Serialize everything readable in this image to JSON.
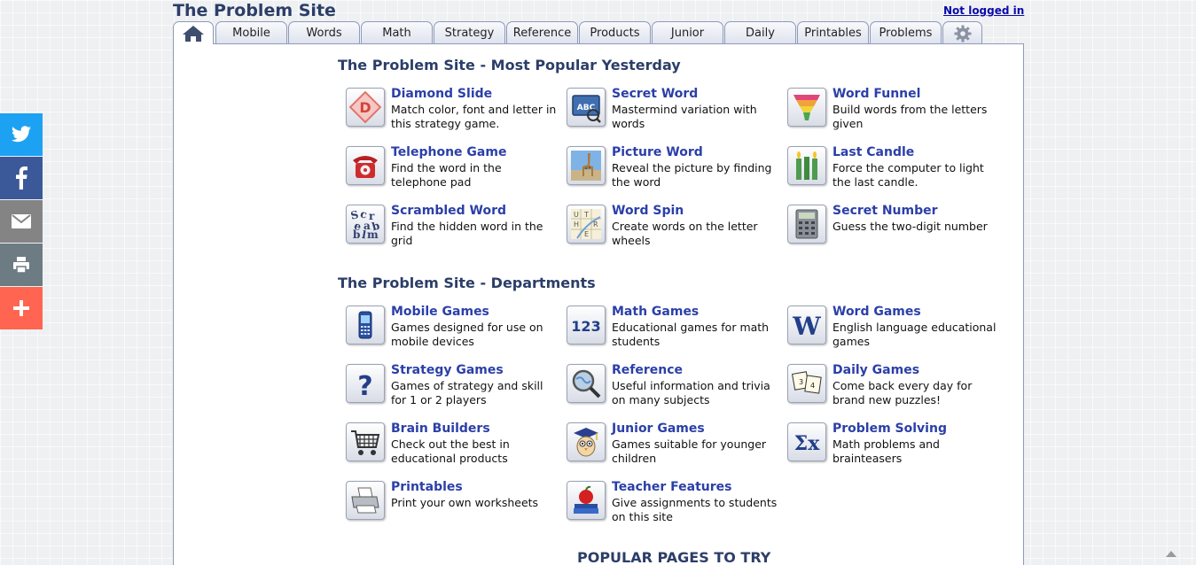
{
  "site": {
    "title": "The Problem Site",
    "login_status": "Not logged in"
  },
  "tabs": [
    {
      "label": "home",
      "icon": "home-icon"
    },
    {
      "label": "Mobile"
    },
    {
      "label": "Words"
    },
    {
      "label": "Math"
    },
    {
      "label": "Strategy"
    },
    {
      "label": "Reference"
    },
    {
      "label": "Products"
    },
    {
      "label": "Junior"
    },
    {
      "label": "Daily"
    },
    {
      "label": "Printables"
    },
    {
      "label": "Problems"
    },
    {
      "label": "settings",
      "icon": "gear-icon"
    }
  ],
  "popular_section": {
    "title": "The Problem Site - Most Popular Yesterday",
    "items": [
      {
        "title": "Diamond Slide",
        "desc": "Match color, font and letter in this strategy game.",
        "icon": "diamond-slide-icon"
      },
      {
        "title": "Secret Word",
        "desc": "Mastermind variation with words",
        "icon": "secret-word-icon"
      },
      {
        "title": "Word Funnel",
        "desc": "Build words from the letters given",
        "icon": "funnel-icon"
      },
      {
        "title": "Telephone Game",
        "desc": "Find the word in the telephone pad",
        "icon": "telephone-icon"
      },
      {
        "title": "Picture Word",
        "desc": "Reveal the picture by finding the word",
        "icon": "giraffe-picture-icon"
      },
      {
        "title": "Last Candle",
        "desc": "Force the computer to light the last candle.",
        "icon": "candles-icon"
      },
      {
        "title": "Scrambled Word",
        "desc": "Find the hidden word in the grid",
        "icon": "scrambled-letters-icon"
      },
      {
        "title": "Word Spin",
        "desc": "Create words on the letter wheels",
        "icon": "word-spin-icon"
      },
      {
        "title": "Secret Number",
        "desc": "Guess the two-digit number",
        "icon": "calculator-icon"
      }
    ]
  },
  "departments_section": {
    "title": "The Problem Site - Departments",
    "items": [
      {
        "title": "Mobile Games",
        "desc": "Games designed for use on mobile devices",
        "icon": "mobile-phone-icon"
      },
      {
        "title": "Math Games",
        "desc": "Educational games for math students",
        "icon": "numbers-123-icon"
      },
      {
        "title": "Word Games",
        "desc": "English language educational games",
        "icon": "letter-w-icon"
      },
      {
        "title": "Strategy Games",
        "desc": "Games of strategy and skill for 1 or 2 players",
        "icon": "question-mark-icon"
      },
      {
        "title": "Reference",
        "desc": "Useful information and trivia on many subjects",
        "icon": "magnifier-globe-icon"
      },
      {
        "title": "Daily Games",
        "desc": "Come back every day for brand new puzzles!",
        "icon": "puzzle-cards-icon"
      },
      {
        "title": "Brain Builders",
        "desc": "Check out the best in educational products",
        "icon": "shopping-cart-icon"
      },
      {
        "title": "Junior Games",
        "desc": "Games suitable for younger children",
        "icon": "graduate-owl-icon"
      },
      {
        "title": "Problem Solving",
        "desc": "Math problems and brainteasers",
        "icon": "sigma-x-icon"
      },
      {
        "title": "Printables",
        "desc": "Print your own worksheets",
        "icon": "printer-icon"
      },
      {
        "title": "Teacher Features",
        "desc": "Give assignments to students on this site",
        "icon": "apple-books-icon"
      }
    ]
  },
  "popular_pages_title": "POPULAR PAGES TO TRY",
  "share": [
    {
      "name": "twitter",
      "icon": "twitter-icon",
      "color": "#1da1f2"
    },
    {
      "name": "facebook",
      "icon": "facebook-icon",
      "color": "#3b5998"
    },
    {
      "name": "email",
      "icon": "email-icon",
      "color": "#848484"
    },
    {
      "name": "print",
      "icon": "print-icon",
      "color": "#6d7b82"
    },
    {
      "name": "more",
      "icon": "plus-icon",
      "color": "#ff6550"
    }
  ],
  "colors": {
    "title": "#2c3e68",
    "link": "#2b3fa8",
    "login": "#0a0aa8"
  }
}
